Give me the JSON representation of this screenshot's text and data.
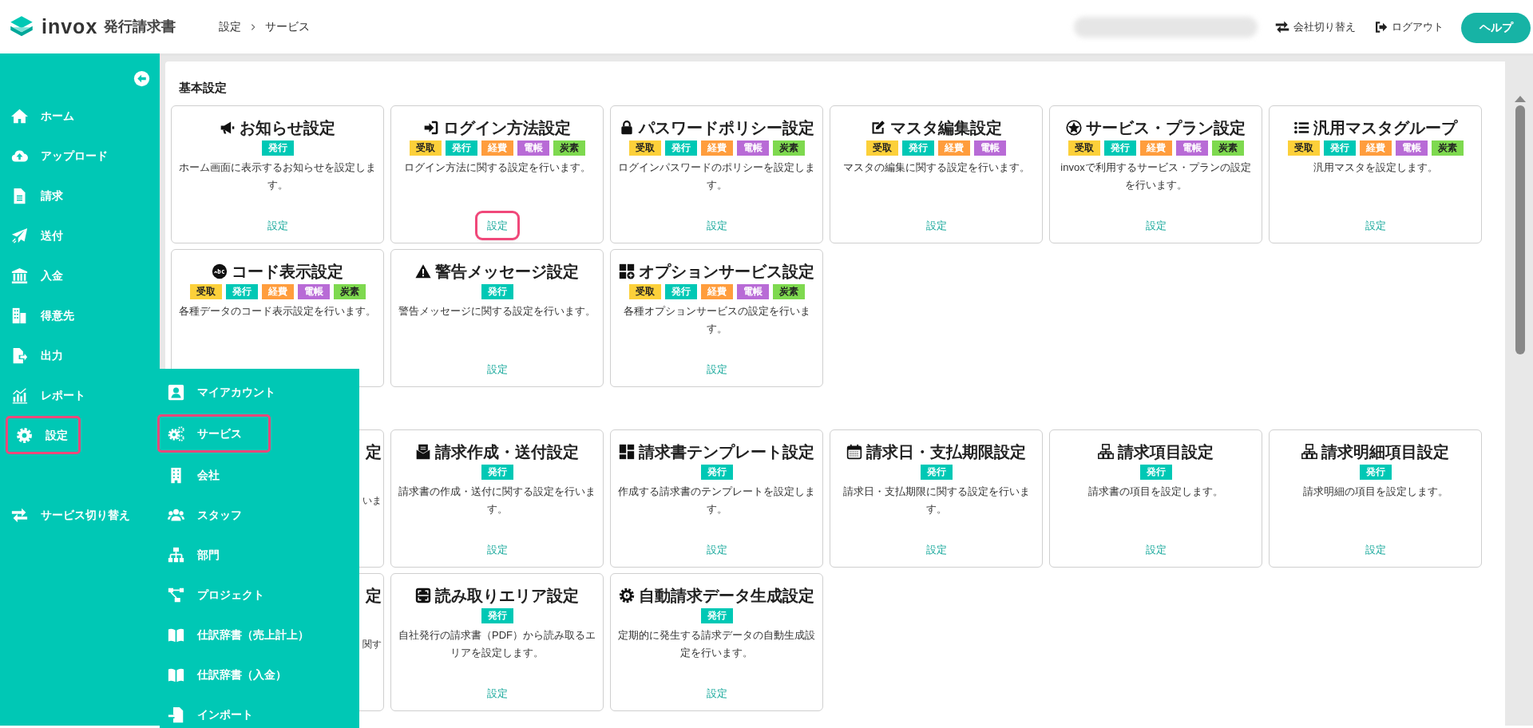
{
  "header": {
    "logo_text": "invox",
    "product": "発行請求書",
    "breadcrumb": [
      "設定",
      "サービス"
    ],
    "actions": [
      {
        "label": "会社切り替え"
      },
      {
        "label": "ログアウト"
      }
    ],
    "help_button": "ヘルプ"
  },
  "sidebar": {
    "items": [
      {
        "label": "ホーム",
        "highlighted": false
      },
      {
        "label": "アップロード",
        "highlighted": false
      },
      {
        "label": "請求",
        "highlighted": false
      },
      {
        "label": "送付",
        "highlighted": false
      },
      {
        "label": "入金",
        "highlighted": false
      },
      {
        "label": "得意先",
        "highlighted": false
      },
      {
        "label": "出力",
        "highlighted": false
      },
      {
        "label": "レポート",
        "highlighted": false
      },
      {
        "label": "設定",
        "highlighted": true
      }
    ],
    "footer_item": {
      "label": "サービス切り替え"
    }
  },
  "submenu": {
    "items": [
      {
        "label": "マイアカウント",
        "highlighted": false
      },
      {
        "label": "サービス",
        "highlighted": true
      },
      {
        "label": "会社",
        "highlighted": false
      },
      {
        "label": "スタッフ",
        "highlighted": false
      },
      {
        "label": "部門",
        "highlighted": false
      },
      {
        "label": "プロジェクト",
        "highlighted": false
      },
      {
        "label": "仕訳辞書（売上計上）",
        "highlighted": false
      },
      {
        "label": "仕訳辞書（入金）",
        "highlighted": false
      },
      {
        "label": "インポート",
        "highlighted": false
      }
    ]
  },
  "sections": [
    {
      "title": "基本設定",
      "cards": [
        {
          "kind": "full",
          "title": "お知らせ設定",
          "tags": [
            {
              "label": "発行",
              "color": "#00c8b5"
            }
          ],
          "description": "ホーム画面に表示するお知らせを設定します。",
          "link": {
            "label": "設定",
            "highlighted": false
          }
        },
        {
          "kind": "full",
          "title": "ログイン方法設定",
          "tags": [
            {
              "label": "受取",
              "color": "#fcd03a"
            },
            {
              "label": "発行",
              "color": "#00c8b5"
            },
            {
              "label": "経費",
              "color": "#ff9d3d"
            },
            {
              "label": "電帳",
              "color": "#b86bd6"
            },
            {
              "label": "炭素",
              "color": "#7ed94f"
            }
          ],
          "description": "ログイン方法に関する設定を行います。",
          "link": {
            "label": "設定",
            "highlighted": true
          }
        },
        {
          "kind": "full",
          "title": "パスワードポリシー設定",
          "tags": [
            {
              "label": "受取",
              "color": "#fcd03a"
            },
            {
              "label": "発行",
              "color": "#00c8b5"
            },
            {
              "label": "経費",
              "color": "#ff9d3d"
            },
            {
              "label": "電帳",
              "color": "#b86bd6"
            },
            {
              "label": "炭素",
              "color": "#7ed94f"
            }
          ],
          "description": "ログインパスワードのポリシーを設定します。",
          "link": {
            "label": "設定",
            "highlighted": false
          }
        },
        {
          "kind": "full",
          "title": "マスタ編集設定",
          "tags": [
            {
              "label": "受取",
              "color": "#fcd03a"
            },
            {
              "label": "発行",
              "color": "#00c8b5"
            },
            {
              "label": "経費",
              "color": "#ff9d3d"
            },
            {
              "label": "電帳",
              "color": "#b86bd6"
            }
          ],
          "description": "マスタの編集に関する設定を行います。",
          "link": {
            "label": "設定",
            "highlighted": false
          }
        },
        {
          "kind": "full",
          "title": "サービス・プラン設定",
          "tags": [
            {
              "label": "受取",
              "color": "#fcd03a"
            },
            {
              "label": "発行",
              "color": "#00c8b5"
            },
            {
              "label": "経費",
              "color": "#ff9d3d"
            },
            {
              "label": "電帳",
              "color": "#b86bd6"
            },
            {
              "label": "炭素",
              "color": "#7ed94f"
            }
          ],
          "description": "invoxで利用するサービス・プランの設定を行います。",
          "link": {
            "label": "設定",
            "highlighted": false
          }
        },
        {
          "kind": "full",
          "title": "汎用マスタグループ",
          "tags": [
            {
              "label": "受取",
              "color": "#fcd03a"
            },
            {
              "label": "発行",
              "color": "#00c8b5"
            },
            {
              "label": "経費",
              "color": "#ff9d3d"
            },
            {
              "label": "電帳",
              "color": "#b86bd6"
            },
            {
              "label": "炭素",
              "color": "#7ed94f"
            }
          ],
          "description": "汎用マスタを設定します。",
          "link": {
            "label": "設定",
            "highlighted": false
          }
        },
        {
          "kind": "full",
          "title": "コード表示設定",
          "tags": [
            {
              "label": "受取",
              "color": "#fcd03a"
            },
            {
              "label": "発行",
              "color": "#00c8b5"
            },
            {
              "label": "経費",
              "color": "#ff9d3d"
            },
            {
              "label": "電帳",
              "color": "#b86bd6"
            },
            {
              "label": "炭素",
              "color": "#7ed94f"
            }
          ],
          "description": "各種データのコード表示設定を行います。"
        },
        {
          "kind": "full",
          "title": "警告メッセージ設定",
          "tags": [
            {
              "label": "発行",
              "color": "#00c8b5"
            }
          ],
          "description": "警告メッセージに関する設定を行います。",
          "link": {
            "label": "設定",
            "highlighted": false
          }
        },
        {
          "kind": "full",
          "title": "オプションサービス設定",
          "tags": [
            {
              "label": "受取",
              "color": "#fcd03a"
            },
            {
              "label": "発行",
              "color": "#00c8b5"
            },
            {
              "label": "経費",
              "color": "#ff9d3d"
            },
            {
              "label": "電帳",
              "color": "#b86bd6"
            },
            {
              "label": "炭素",
              "color": "#7ed94f"
            }
          ],
          "description": "各種オプションサービスの設定を行います。",
          "link": {
            "label": "設定",
            "highlighted": false
          }
        }
      ]
    },
    {
      "cards": [
        {
          "kind": "partial",
          "title": "定",
          "description": "いま"
        },
        {
          "kind": "full",
          "title": "請求作成・送付設定",
          "tags": [
            {
              "label": "発行",
              "color": "#00c8b5"
            }
          ],
          "description": "請求書の作成・送付に関する設定を行います。",
          "link": {
            "label": "設定",
            "highlighted": false
          }
        },
        {
          "kind": "full",
          "title": "請求書テンプレート設定",
          "tags": [
            {
              "label": "発行",
              "color": "#00c8b5"
            }
          ],
          "description": "作成する請求書のテンプレートを設定します。",
          "link": {
            "label": "設定",
            "highlighted": false
          }
        },
        {
          "kind": "full",
          "title": "請求日・支払期限設定",
          "tags": [
            {
              "label": "発行",
              "color": "#00c8b5"
            }
          ],
          "description": "請求日・支払期限に関する設定を行います。",
          "link": {
            "label": "設定",
            "highlighted": false
          }
        },
        {
          "kind": "full",
          "title": "請求項目設定",
          "tags": [
            {
              "label": "発行",
              "color": "#00c8b5"
            }
          ],
          "description": "請求書の項目を設定します。",
          "link": {
            "label": "設定",
            "highlighted": false
          }
        },
        {
          "kind": "full",
          "title": "請求明細項目設定",
          "tags": [
            {
              "label": "発行",
              "color": "#00c8b5"
            }
          ],
          "description": "請求明細の項目を設定します。",
          "link": {
            "label": "設定",
            "highlighted": false
          }
        },
        {
          "kind": "partial",
          "title": "定",
          "description": "関す"
        },
        {
          "kind": "full",
          "title": "読み取りエリア設定",
          "tags": [
            {
              "label": "発行",
              "color": "#00c8b5"
            }
          ],
          "description": "自社発行の請求書（PDF）から読み取るエリアを設定します。",
          "link": {
            "label": "設定",
            "highlighted": false
          }
        },
        {
          "kind": "full",
          "title": "自動請求データ生成設定",
          "tags": [
            {
              "label": "発行",
              "color": "#00c8b5"
            }
          ],
          "description": "定期的に発生する請求データの自動生成設定を行います。",
          "link": {
            "label": "設定",
            "highlighted": false
          }
        }
      ]
    }
  ]
}
